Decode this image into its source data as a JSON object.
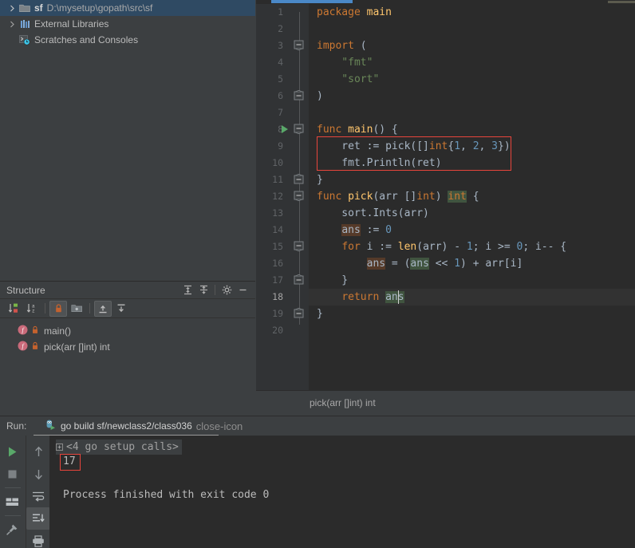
{
  "project_tree": {
    "items": [
      {
        "label": "sf",
        "path": "D:\\mysetup\\gopath\\src\\sf",
        "icon": "folder-module-icon",
        "arrow": "chevron-right-icon",
        "selected": true
      },
      {
        "label": "External Libraries",
        "icon": "library-icon",
        "arrow": "chevron-right-icon",
        "selected": false
      },
      {
        "label": "Scratches and Consoles",
        "icon": "scratches-icon",
        "arrow": "",
        "selected": false
      }
    ]
  },
  "structure": {
    "title": "Structure",
    "header_buttons": [
      {
        "name": "expand-all-icon",
        "label": "Expand All"
      },
      {
        "name": "collapse-all-icon",
        "label": "Collapse All"
      },
      {
        "name": "gear-icon",
        "label": "Settings"
      },
      {
        "name": "minimize-icon",
        "label": "Hide"
      }
    ],
    "toolbar_buttons": [
      {
        "name": "sort-by-visibility-icon",
        "label": "Sort by Visibility",
        "active": false
      },
      {
        "name": "sort-alphabetically-icon",
        "label": "Sort Alphabetically",
        "active": false
      },
      {
        "name": "show-non-public-icon",
        "label": "Show Non-Public",
        "active": true
      },
      {
        "name": "group-icon",
        "label": "Group",
        "active": false
      },
      {
        "name": "expand-all-icon",
        "label": "Expand All",
        "active": true
      },
      {
        "name": "collapse-all-icon",
        "label": "Collapse All",
        "active": false
      }
    ],
    "items": [
      {
        "label": "main()",
        "kind": "f",
        "access": "lock-icon"
      },
      {
        "label": "pick(arr []int) int",
        "kind": "f",
        "access": "lock-icon"
      }
    ]
  },
  "editor": {
    "breadcrumb": "pick(arr []int) int",
    "line_numbers": [
      "1",
      "2",
      "3",
      "4",
      "5",
      "6",
      "7",
      "8",
      "9",
      "10",
      "11",
      "12",
      "13",
      "14",
      "15",
      "16",
      "17",
      "18",
      "19",
      "20"
    ],
    "caret_line": 18,
    "run_marker": "run-gutter-icon",
    "lines": [
      {
        "n": 1,
        "text": "package main"
      },
      {
        "n": 2,
        "text": ""
      },
      {
        "n": 3,
        "text": "import ("
      },
      {
        "n": 4,
        "text": "    \"fmt\""
      },
      {
        "n": 5,
        "text": "    \"sort\""
      },
      {
        "n": 6,
        "text": ")"
      },
      {
        "n": 7,
        "text": ""
      },
      {
        "n": 8,
        "text": "func main() {"
      },
      {
        "n": 9,
        "text": "    ret := pick([]int{1, 2, 3})"
      },
      {
        "n": 10,
        "text": "    fmt.Println(ret)"
      },
      {
        "n": 11,
        "text": "}"
      },
      {
        "n": 12,
        "text": "func pick(arr []int) int {"
      },
      {
        "n": 13,
        "text": "    sort.Ints(arr)"
      },
      {
        "n": 14,
        "text": "    ans := 0"
      },
      {
        "n": 15,
        "text": "    for i := len(arr) - 1; i >= 0; i-- {"
      },
      {
        "n": 16,
        "text": "        ans = (ans << 1) + arr[i]"
      },
      {
        "n": 17,
        "text": "    }"
      },
      {
        "n": 18,
        "text": "    return ans"
      },
      {
        "n": 19,
        "text": "}"
      },
      {
        "n": 20,
        "text": ""
      }
    ],
    "highlight_box_lines": [
      9,
      10
    ]
  },
  "run_panel": {
    "label": "Run:",
    "tab_title": "go build sf/newclass2/class036",
    "tab_icon": "go-run-icon",
    "close_icon": "close-icon",
    "left_buttons": [
      {
        "name": "rerun-icon",
        "label": "Rerun",
        "active": false
      },
      {
        "name": "stop-icon",
        "label": "Stop",
        "active": false
      },
      {
        "name": "layout-icon",
        "label": "Layout",
        "active": false
      },
      {
        "name": "pin-icon",
        "label": "Pin Tab",
        "active": false
      }
    ],
    "right_buttons": [
      {
        "name": "arrow-up-icon",
        "label": "Previous",
        "active": false
      },
      {
        "name": "arrow-down-icon",
        "label": "Next",
        "active": false
      },
      {
        "name": "soft-wrap-icon",
        "label": "Soft-Wrap",
        "active": false
      },
      {
        "name": "scroll-to-end-icon",
        "label": "Scroll to End",
        "active": true
      },
      {
        "name": "print-icon",
        "label": "Print",
        "active": false
      }
    ],
    "console": {
      "folded_line": "<4 go setup calls>",
      "output_value": "17",
      "finish_line": "Process finished with exit code 0"
    }
  },
  "colors": {
    "selection_blue": "#2f4a63",
    "keyword_orange": "#cc7832",
    "string_green": "#6a8759",
    "number_blue": "#6897bb",
    "function_yellow": "#ffc66d",
    "annotation_red": "#e8453c",
    "scrollbar_blue": "#4a88c7"
  }
}
